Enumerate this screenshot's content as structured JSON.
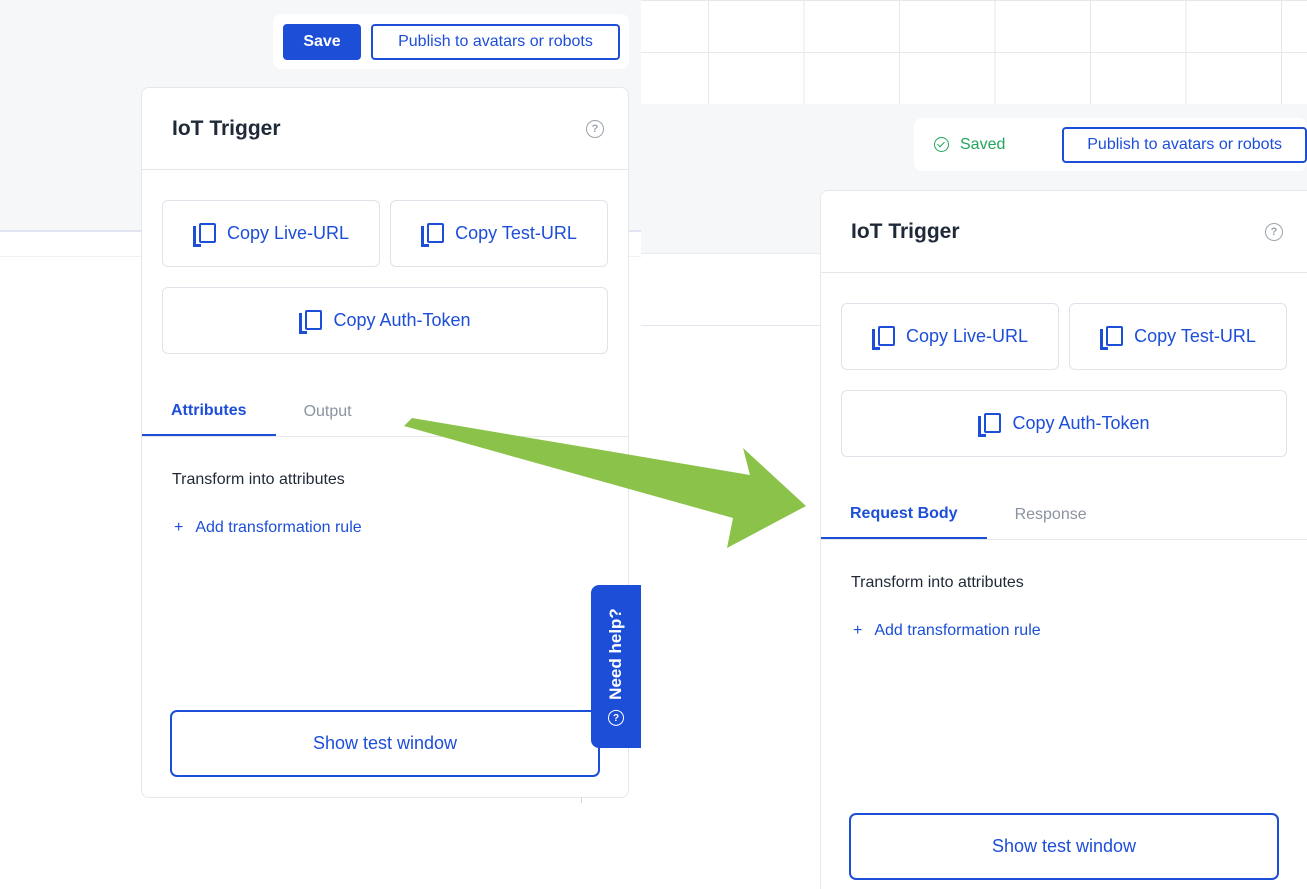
{
  "toolbar_before": {
    "save_label": "Save",
    "publish_label": "Publish to avatars or robots"
  },
  "toolbar_after": {
    "saved_label": "Saved",
    "publish_label": "Publish to avatars or robots"
  },
  "panel_before": {
    "title": "IoT Trigger",
    "help_glyph": "?",
    "copy_live_url": "Copy Live-URL",
    "copy_test_url": "Copy Test-URL",
    "copy_auth_token": "Copy Auth-Token",
    "tabs": [
      {
        "label": "Attributes",
        "active": true
      },
      {
        "label": "Output",
        "active": false
      }
    ],
    "section_label": "Transform into attributes",
    "add_rule_plus": "+",
    "add_rule_label": "Add transformation rule",
    "test_window_label": "Show test window"
  },
  "panel_after": {
    "title": "IoT Trigger",
    "help_glyph": "?",
    "copy_live_url": "Copy Live-URL",
    "copy_test_url": "Copy Test-URL",
    "copy_auth_token": "Copy Auth-Token",
    "tabs": [
      {
        "label": "Request Body",
        "active": true
      },
      {
        "label": "Response",
        "active": false
      }
    ],
    "section_label": "Transform into attributes",
    "add_rule_plus": "+",
    "add_rule_label": "Add transformation rule",
    "test_window_label": "Show test window"
  },
  "need_help": {
    "label": "Need help?",
    "glyph": "?"
  },
  "colors": {
    "primary": "#1d4ed8",
    "success": "#22a55b",
    "arrow": "#8bc34a",
    "muted_text": "#8b93a1"
  },
  "icons": [
    "copy-icon",
    "help-circle-icon",
    "check-circle-icon",
    "plus-icon",
    "arrow-right-icon"
  ]
}
